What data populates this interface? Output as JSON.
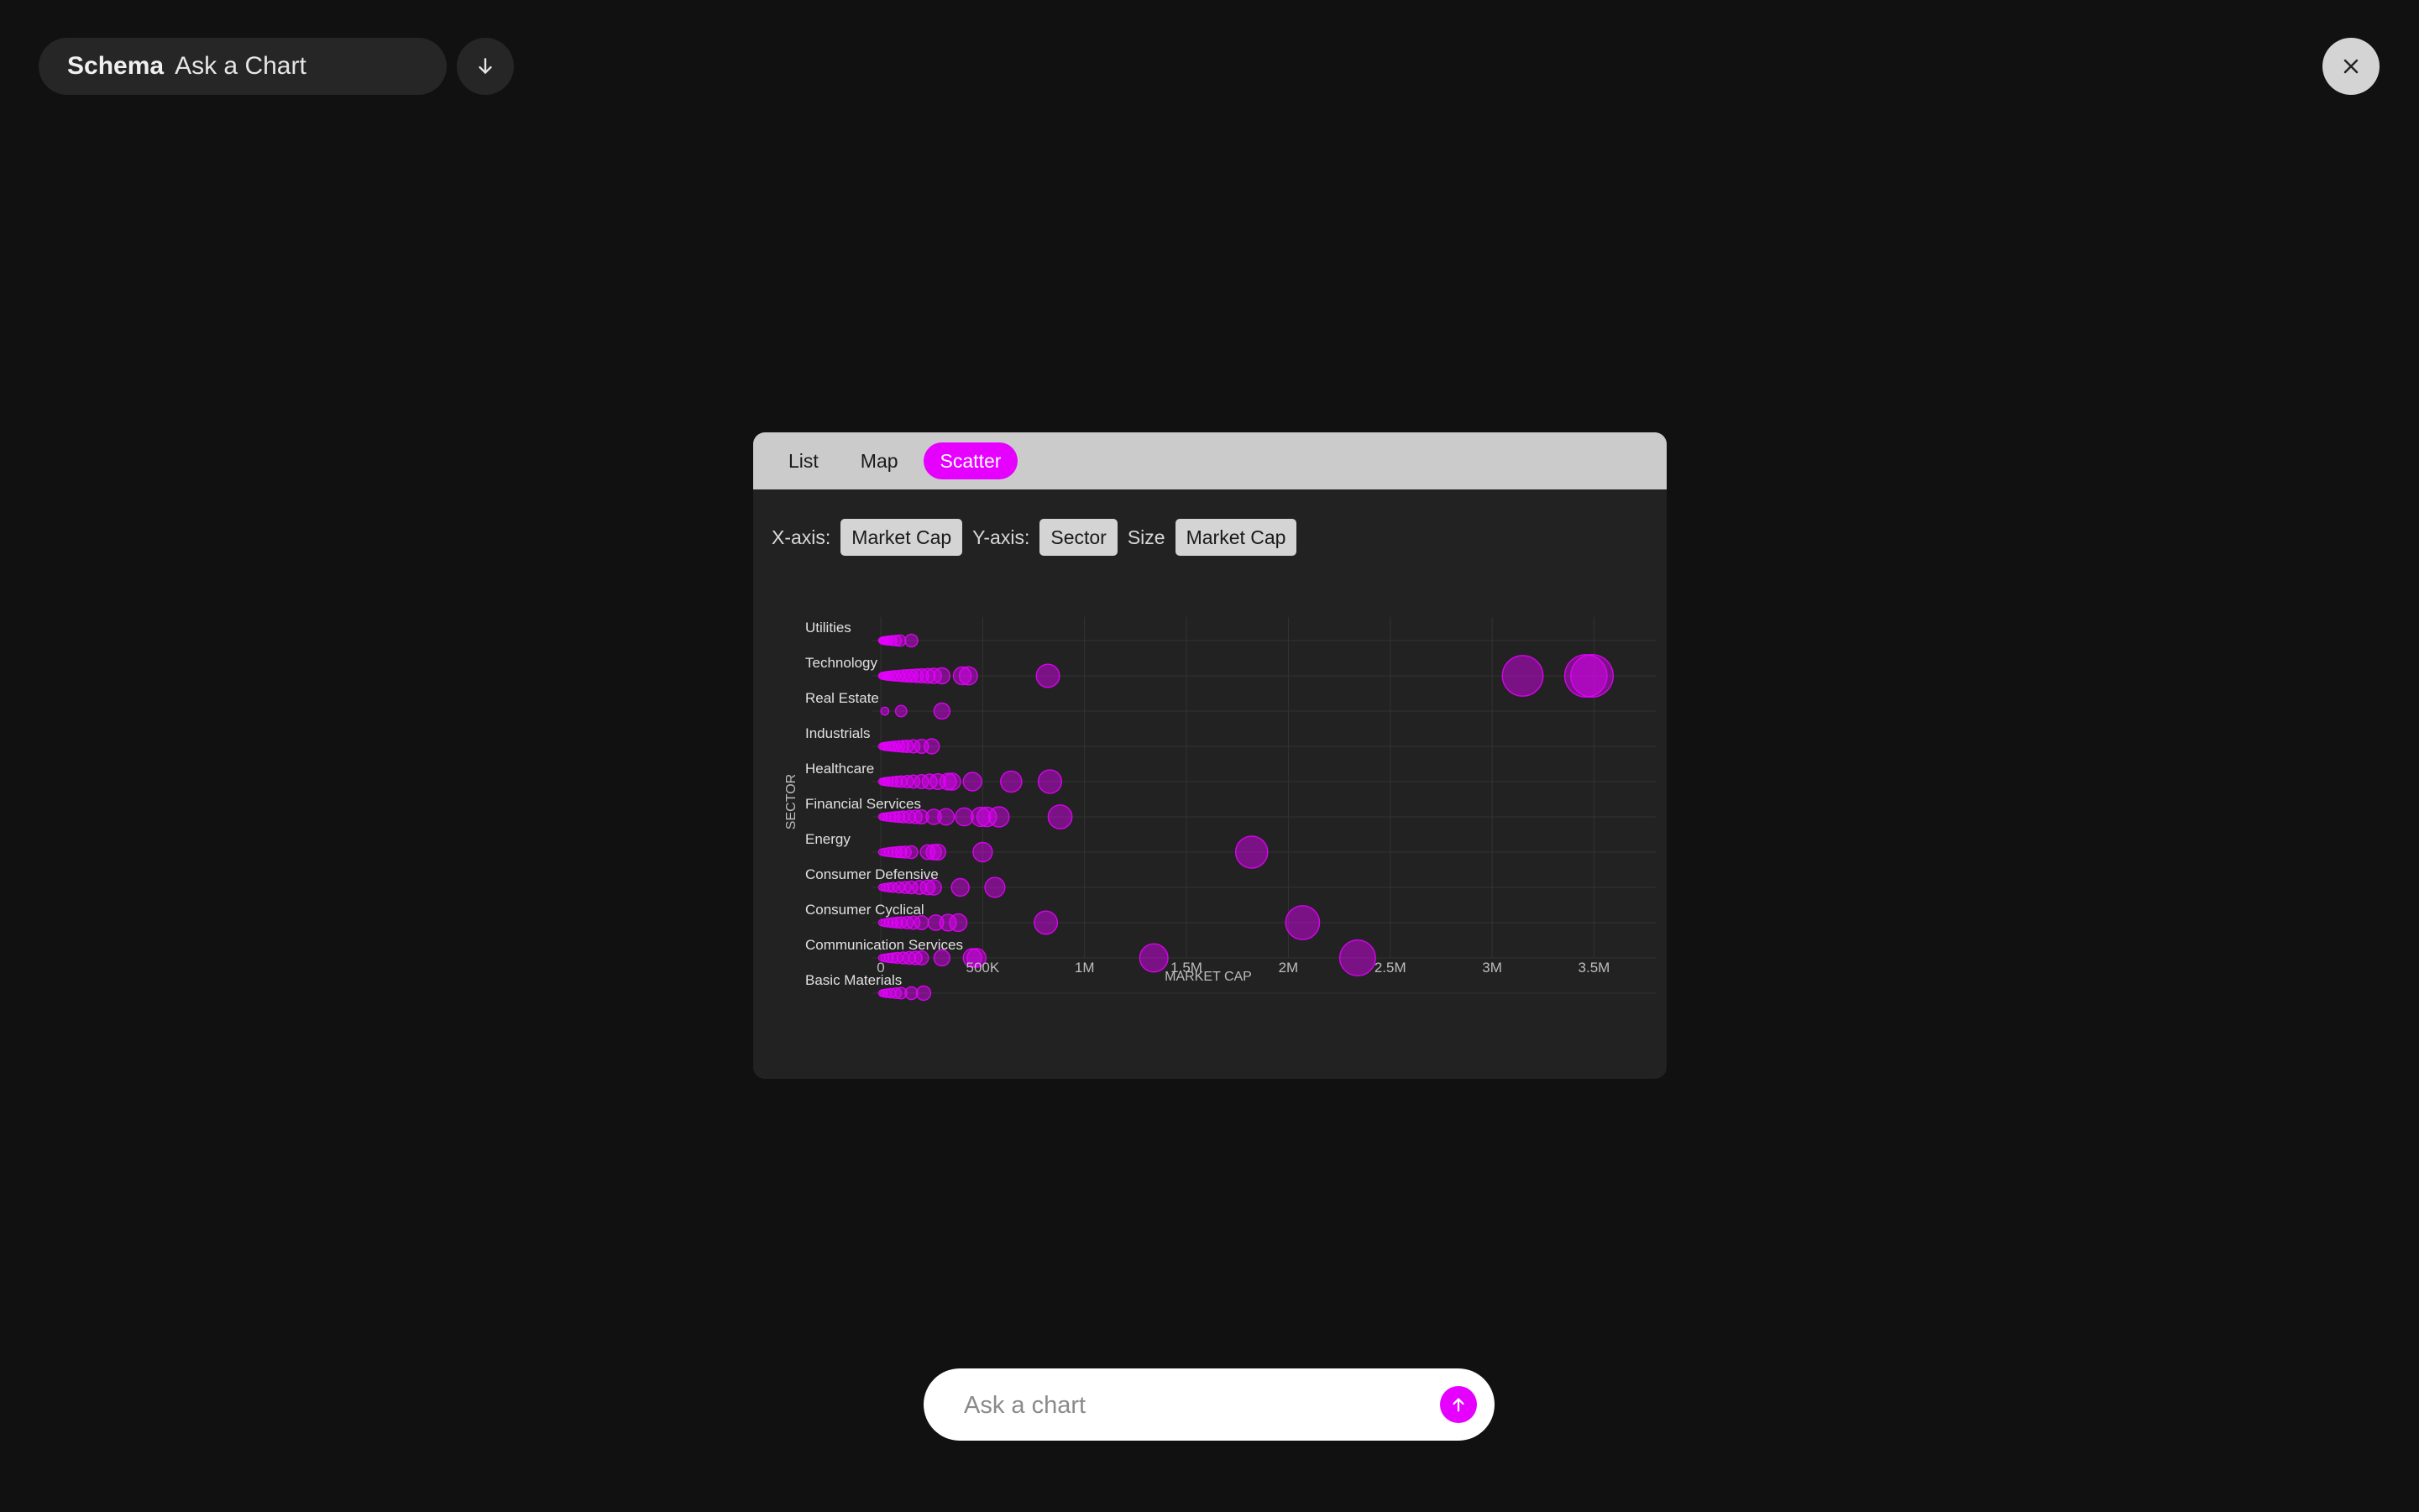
{
  "header": {
    "brand": "Schema",
    "title": "Ask a Chart",
    "download_icon": "arrow-down-icon",
    "close_icon": "close-icon"
  },
  "tabs": [
    {
      "label": "List",
      "active": false
    },
    {
      "label": "Map",
      "active": false
    },
    {
      "label": "Scatter",
      "active": true
    }
  ],
  "controls": {
    "x_label": "X-axis:",
    "x_value": "Market Cap",
    "y_label": "Y-axis:",
    "y_value": "Sector",
    "size_label": "Size",
    "size_value": "Market Cap"
  },
  "ask": {
    "placeholder": "Ask a chart",
    "send_icon": "arrow-up-icon"
  },
  "colors": {
    "accent": "#e600ff",
    "background": "#111111",
    "panel": "#222222"
  },
  "chart_data": {
    "type": "scatter",
    "xlabel": "MARKET CAP",
    "ylabel": "SECTOR",
    "xlim": [
      0,
      3700000
    ],
    "x_ticks": [
      0,
      500000,
      1000000,
      1500000,
      2000000,
      2500000,
      3000000,
      3500000
    ],
    "x_tick_labels": [
      "0",
      "500K",
      "1M",
      "1.5M",
      "2M",
      "2.5M",
      "3M",
      "3.5M"
    ],
    "categories": [
      "Basic Materials",
      "Communication Services",
      "Consumer Cyclical",
      "Consumer Defensive",
      "Energy",
      "Financial Services",
      "Healthcare",
      "Industrials",
      "Real Estate",
      "Technology",
      "Utilities"
    ],
    "grid": true,
    "size_by": "x",
    "series": [
      {
        "category": "Utilities",
        "x": [
          5000,
          10000,
          15000,
          20000,
          30000,
          40000,
          55000,
          75000,
          95000,
          150000
        ]
      },
      {
        "category": "Technology",
        "x": [
          5000,
          10000,
          20000,
          30000,
          40000,
          55000,
          70000,
          90000,
          110000,
          130000,
          150000,
          175000,
          200000,
          230000,
          260000,
          300000,
          400000,
          430000,
          820000,
          3150000,
          3460000,
          3490000
        ]
      },
      {
        "category": "Real Estate",
        "x": [
          20000,
          100000,
          300000
        ]
      },
      {
        "category": "Industrials",
        "x": [
          5000,
          15000,
          25000,
          40000,
          55000,
          70000,
          90000,
          110000,
          130000,
          160000,
          200000,
          250000
        ]
      },
      {
        "category": "Healthcare",
        "x": [
          5000,
          15000,
          25000,
          40000,
          60000,
          80000,
          100000,
          130000,
          160000,
          200000,
          240000,
          280000,
          330000,
          350000,
          450000,
          640000,
          830000
        ]
      },
      {
        "category": "Financial Services",
        "x": [
          5000,
          15000,
          30000,
          50000,
          70000,
          90000,
          110000,
          140000,
          170000,
          200000,
          260000,
          320000,
          410000,
          490000,
          520000,
          580000,
          880000
        ]
      },
      {
        "category": "Energy",
        "x": [
          5000,
          20000,
          40000,
          60000,
          80000,
          100000,
          120000,
          150000,
          230000,
          260000,
          280000,
          500000,
          1820000
        ]
      },
      {
        "category": "Consumer Defensive",
        "x": [
          5000,
          20000,
          40000,
          60000,
          90000,
          120000,
          150000,
          190000,
          230000,
          260000,
          390000,
          560000
        ]
      },
      {
        "category": "Consumer Cyclical",
        "x": [
          5000,
          20000,
          40000,
          60000,
          80000,
          100000,
          130000,
          160000,
          200000,
          270000,
          330000,
          380000,
          810000,
          2070000
        ]
      },
      {
        "category": "Communication Services",
        "x": [
          5000,
          20000,
          40000,
          60000,
          80000,
          110000,
          140000,
          170000,
          200000,
          300000,
          450000,
          470000,
          1340000,
          2340000
        ]
      },
      {
        "category": "Basic Materials",
        "x": [
          5000,
          15000,
          30000,
          50000,
          75000,
          100000,
          150000,
          210000
        ]
      }
    ]
  }
}
